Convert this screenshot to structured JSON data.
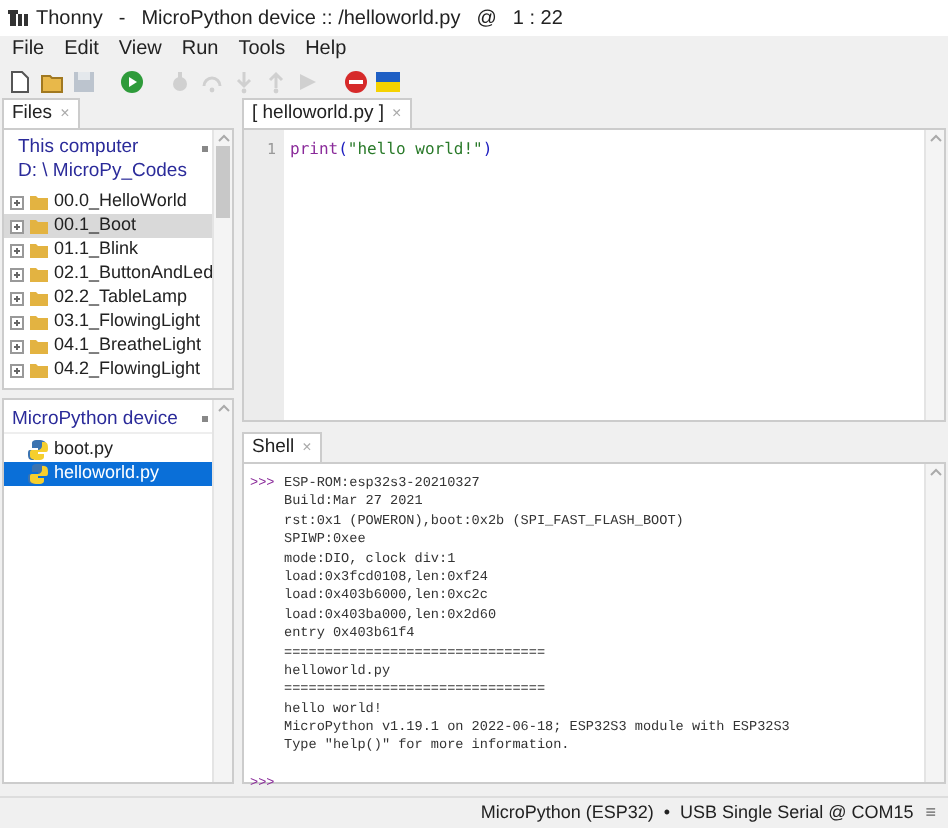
{
  "window": {
    "app": "Thonny",
    "separator": "-",
    "title": "MicroPython device :: /helloworld.py",
    "at": "@",
    "position": "1 : 22"
  },
  "menu": [
    "File",
    "Edit",
    "View",
    "Run",
    "Tools",
    "Help"
  ],
  "toolbar": [
    {
      "kind": "new",
      "disabled": false
    },
    {
      "kind": "open",
      "disabled": false
    },
    {
      "kind": "save",
      "disabled": true
    },
    {
      "kind": "run",
      "disabled": false
    },
    {
      "kind": "debug",
      "disabled": true
    },
    {
      "kind": "step_over",
      "disabled": true
    },
    {
      "kind": "step_into",
      "disabled": true
    },
    {
      "kind": "step_out",
      "disabled": true
    },
    {
      "kind": "resume",
      "disabled": true
    },
    {
      "kind": "stop",
      "disabled": false
    },
    {
      "kind": "flag",
      "disabled": false
    }
  ],
  "files_tab": {
    "label": "Files",
    "close": "×"
  },
  "this_computer": {
    "title": "This computer",
    "path": "D: \\ MicroPy_Codes",
    "items": [
      {
        "name": "00.0_HelloWorld",
        "selected": false
      },
      {
        "name": "00.1_Boot",
        "selected": true
      },
      {
        "name": "01.1_Blink",
        "selected": false
      },
      {
        "name": "02.1_ButtonAndLed",
        "selected": false
      },
      {
        "name": "02.2_TableLamp",
        "selected": false
      },
      {
        "name": "03.1_FlowingLight",
        "selected": false
      },
      {
        "name": "04.1_BreatheLight",
        "selected": false
      },
      {
        "name": "04.2_FlowingLight",
        "selected": false
      }
    ]
  },
  "device": {
    "title": "MicroPython device",
    "items": [
      {
        "name": "boot.py",
        "selected": false
      },
      {
        "name": "helloworld.py",
        "selected": true
      }
    ]
  },
  "editor_tab": {
    "label": "[ helloworld.py ]",
    "close": "×"
  },
  "editor": {
    "lines": [
      {
        "number": "1",
        "tokens": [
          {
            "kind": "builtin",
            "text": "print"
          },
          {
            "kind": "paren",
            "text": "("
          },
          {
            "kind": "string",
            "text": "\"hello world!\""
          },
          {
            "kind": "paren",
            "text": ")"
          }
        ]
      }
    ]
  },
  "shell_tab": {
    "label": "Shell",
    "close": "×"
  },
  "shell": {
    "lines": [
      {
        "prompt": ">>>",
        "text": "ESP-ROM:esp32s3-20210327"
      },
      {
        "text": "Build:Mar 27 2021"
      },
      {
        "text": "rst:0x1 (POWERON),boot:0x2b (SPI_FAST_FLASH_BOOT)"
      },
      {
        "text": "SPIWP:0xee"
      },
      {
        "text": "mode:DIO, clock div:1"
      },
      {
        "text": "load:0x3fcd0108,len:0xf24"
      },
      {
        "text": "load:0x403b6000,len:0xc2c"
      },
      {
        "text": "load:0x403ba000,len:0x2d60"
      },
      {
        "text": "entry 0x403b61f4"
      },
      {
        "text": "================================"
      },
      {
        "text": "helloworld.py"
      },
      {
        "text": "================================"
      },
      {
        "text": "hello world!"
      },
      {
        "text": "MicroPython v1.19.1 on 2022-06-18; ESP32S3 module with ESP32S3"
      },
      {
        "text": "Type \"help()\" for more information."
      },
      {
        "prompt": ">>>"
      }
    ]
  },
  "status_bar": {
    "text": "MicroPython (ESP32)  •  USB Single Serial @ COM15",
    "menu": "≡"
  }
}
